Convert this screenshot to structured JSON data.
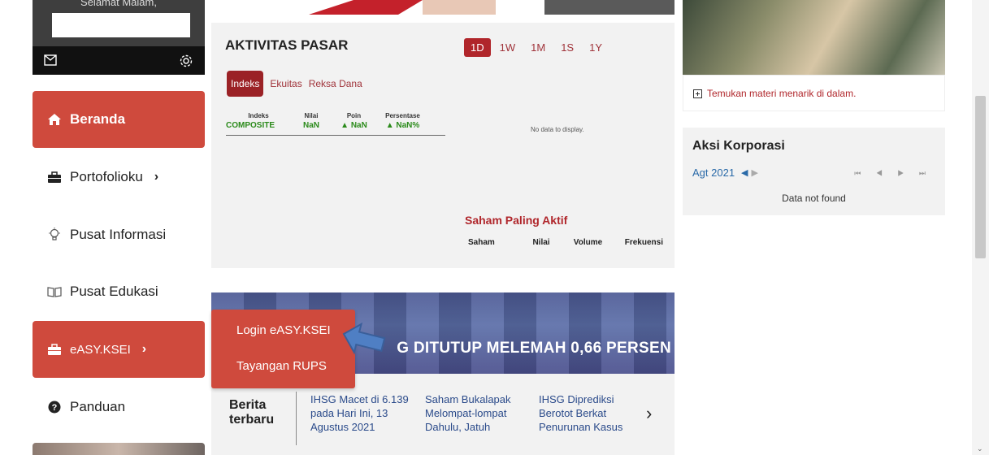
{
  "profile": {
    "greeting": "Selamat Malam,",
    "mail_icon": "mail-icon",
    "settings_icon": "gear-icon"
  },
  "sidebar": {
    "items": [
      {
        "label": "Beranda",
        "icon": "home-icon",
        "active": true
      },
      {
        "label": "Portofolioku",
        "icon": "briefcase-icon",
        "chevron": "›"
      },
      {
        "label": "Pusat Informasi",
        "icon": "lightbulb-icon"
      },
      {
        "label": "Pusat Edukasi",
        "icon": "book-icon"
      },
      {
        "label": "eASY.KSEI",
        "icon": "briefcase-icon",
        "active": true,
        "chevron": "›"
      },
      {
        "label": "Panduan",
        "icon": "question-icon"
      }
    ]
  },
  "easy_menu": {
    "items": [
      "Login eASY.KSEI",
      "Tayangan RUPS"
    ]
  },
  "market": {
    "title": "AKTIVITAS PASAR",
    "periods": [
      "1D",
      "1W",
      "1M",
      "1S",
      "1Y"
    ],
    "active_period": "1D",
    "subtabs": [
      "Indeks",
      "Ekuitas",
      "Reksa Dana"
    ],
    "active_subtab": "Indeks",
    "index_table": {
      "headers": [
        "Indeks",
        "Nilai",
        "Poin",
        "Persentase"
      ],
      "rows": [
        [
          "COMPOSITE",
          "NaN",
          "▲ NaN",
          "▲ NaN%"
        ]
      ]
    },
    "no_data": "No data to display.",
    "active_stocks_title": "Saham Paling Aktif",
    "active_stocks_headers": [
      "Saham",
      "Nilai",
      "Volume",
      "Frekuensi"
    ]
  },
  "news": {
    "banner_headline": "G DITUTUP MELEMAH 0,66 PERSEN",
    "label": "Berita terbaru",
    "items": [
      "IHSG Macet di 6.139 pada Hari Ini, 13 Agustus 2021",
      "Saham Bukalapak Melompat-lompat Dahulu, Jatuh",
      "IHSG Diprediksi Berotot Berkat Penurunan Kasus"
    ],
    "next": "›"
  },
  "materi": {
    "text": "Temukan materi menarik di dalam."
  },
  "aksi": {
    "title": "Aksi Korporasi",
    "month": "Agt 2021",
    "empty": "Data not found",
    "pager": "⏮ ◀ ▶ ⏭"
  },
  "colors": {
    "accent": "#cf4a3d",
    "dark_red": "#9b2226",
    "link_blue": "#2a6aa8",
    "positive_green": "#2a8a1a"
  }
}
